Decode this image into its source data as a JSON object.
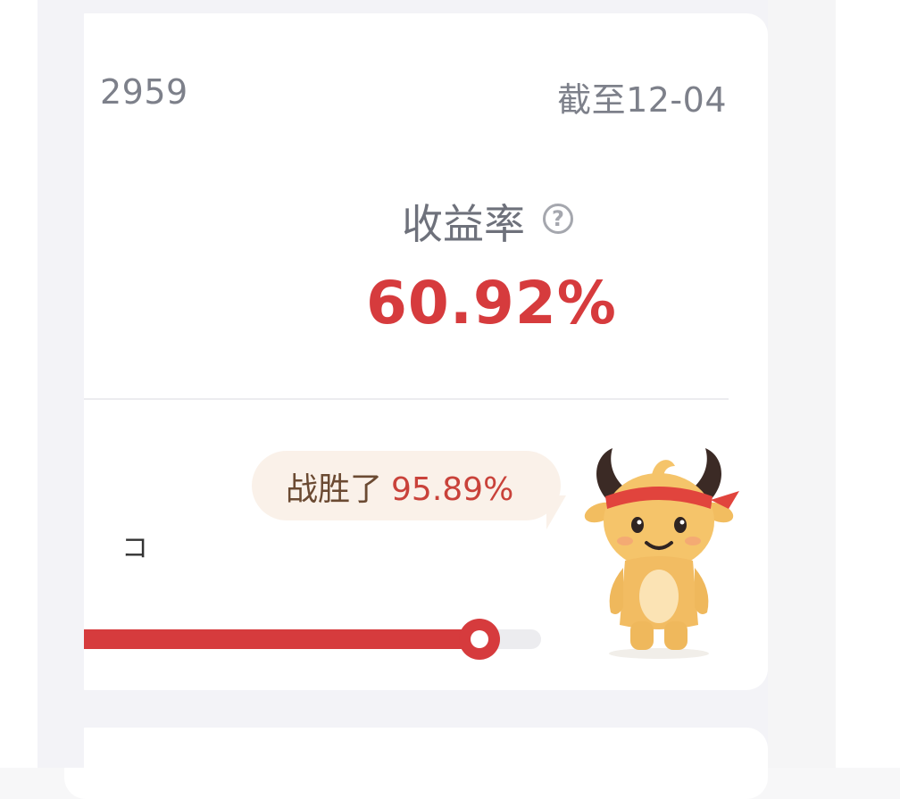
{
  "account": {
    "number_text": "2959"
  },
  "as_of": "截至12-04",
  "return_rate": {
    "label": "收益率",
    "value": "60.92%"
  },
  "ranking": {
    "label": "战胜了",
    "value": "95.89%",
    "percent": 95.89
  },
  "side_label_fragment": "コ",
  "colors": {
    "accent_red": "#d63b3d",
    "bubble_bg": "#faf1e9",
    "text_gray": "#7d808a"
  }
}
